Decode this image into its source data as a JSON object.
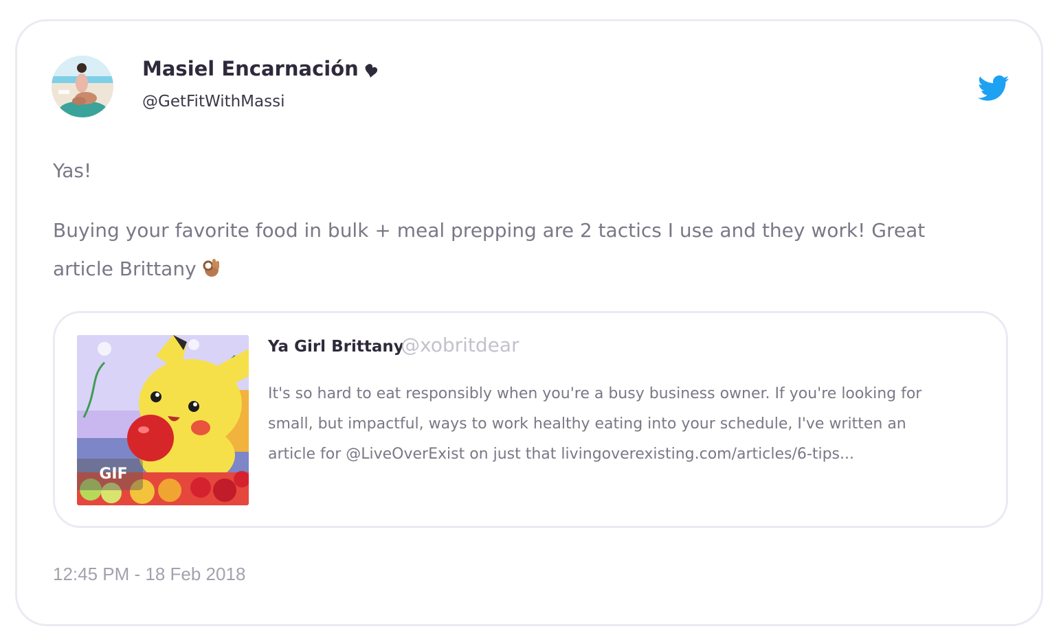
{
  "tweet": {
    "author_name": "Masiel Encarnación",
    "author_handle": "@GetFitWithMassi",
    "name_emoji_icon": "heart-emoji-icon",
    "brand_icon": "twitter-bird-icon",
    "text_lines": [
      "Yas!",
      "Buying your favorite food in bulk + meal prepping are 2 tactics I use and they work! Great",
      "article Brittany"
    ],
    "trailing_emoji_icon": "ok-hand-emoji-icon",
    "timestamp": "12:45 PM - 18 Feb 2018"
  },
  "quoted_tweet": {
    "author_name": "Ya Girl Brittany",
    "author_handle": "@xobritdear",
    "media_badge": "GIF",
    "text_lines": [
      "It's so hard to eat responsibly when you're a busy business owner. If you're looking for",
      "small, but impactful, ways to work healthy eating into your schedule, I've written an",
      "article for @LiveOverExist on just that livingoverexisting.com/articles/6-tips..."
    ]
  },
  "colors": {
    "twitter_blue": "#1da1f2",
    "card_border": "#ece9f3",
    "body_text": "#7b7786",
    "name_text": "#2f2a3b"
  }
}
